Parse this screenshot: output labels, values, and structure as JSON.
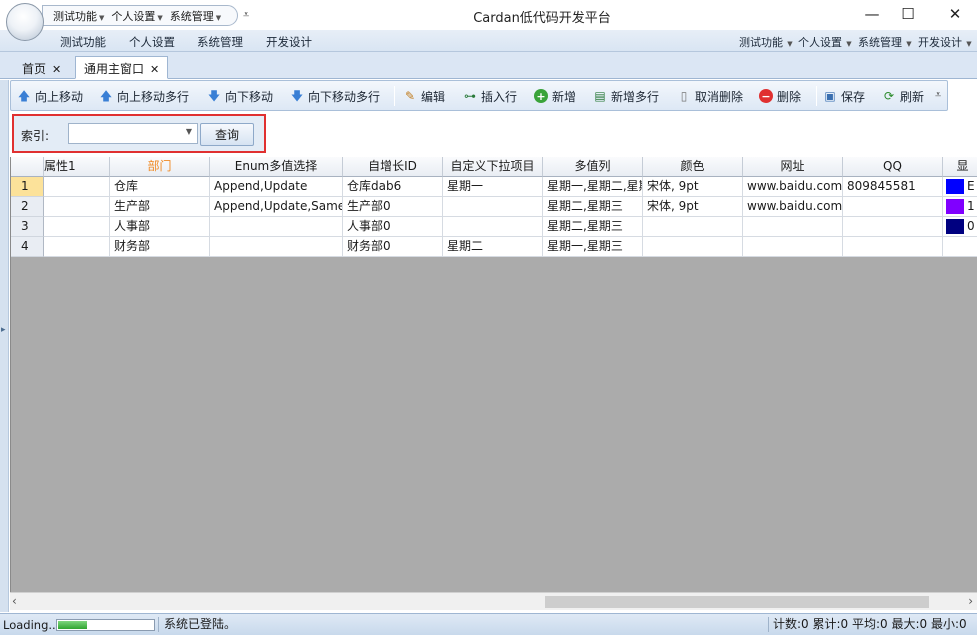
{
  "app": {
    "title": "Cardan低代码开发平台"
  },
  "quick_access": {
    "items": [
      "测试功能",
      "个人设置",
      "系统管理"
    ],
    "more": "⩡"
  },
  "ribbon": {
    "tabs": [
      "测试功能",
      "个人设置",
      "系统管理",
      "开发设计"
    ],
    "menus": [
      "测试功能",
      "个人设置",
      "系统管理",
      "开发设计"
    ]
  },
  "doc_tabs": [
    {
      "label": "首页",
      "close": "✕"
    },
    {
      "label": "通用主窗口",
      "close": "✕"
    }
  ],
  "toolbar": {
    "buttons": [
      {
        "icon": "arrow-up-icon",
        "label": "向上移动"
      },
      {
        "icon": "arrow-up-multi-icon",
        "label": "向上移动多行"
      },
      {
        "icon": "arrow-down-icon",
        "label": "向下移动"
      },
      {
        "icon": "arrow-down-multi-icon",
        "label": "向下移动多行"
      },
      {
        "icon": "edit-icon",
        "label": "编辑"
      },
      {
        "icon": "insert-row-icon",
        "label": "插入行"
      },
      {
        "icon": "add-icon",
        "label": "新增"
      },
      {
        "icon": "add-multi-icon",
        "label": "新增多行"
      },
      {
        "icon": "trash-icon",
        "label": "取消删除"
      },
      {
        "icon": "delete-icon",
        "label": "删除"
      },
      {
        "icon": "save-icon",
        "label": "保存"
      },
      {
        "icon": "refresh-icon",
        "label": "刷新"
      }
    ]
  },
  "query": {
    "label": "索引:",
    "value": "",
    "button": "查询"
  },
  "grid": {
    "columns": [
      "属性1",
      "部门",
      "Enum多值选择",
      "自增长ID",
      "自定义下拉项目",
      "多值列",
      "颜色",
      "网址",
      "QQ",
      "显"
    ],
    "selected_column": 1,
    "rows": [
      {
        "num": "1",
        "cells": [
          "",
          "仓库",
          "Append,Update",
          "仓库dab6",
          "星期一",
          "星期一,星期二,星期",
          "宋体, 9pt",
          "www.baidu.com",
          "809845581",
          "E"
        ],
        "color": "#0000ff"
      },
      {
        "num": "2",
        "cells": [
          "",
          "生产部",
          "Append,Update,Same",
          "生产部0",
          "",
          "星期二,星期三",
          "宋体, 9pt",
          "www.baidu.com",
          "",
          "1"
        ],
        "color": "#8000ff"
      },
      {
        "num": "3",
        "cells": [
          "",
          "人事部",
          "",
          "人事部0",
          "",
          "星期二,星期三",
          "",
          "",
          "",
          "0"
        ],
        "color": "#000080"
      },
      {
        "num": "4",
        "cells": [
          "",
          "财务部",
          "",
          "财务部0",
          "星期二",
          "星期一,星期三",
          "",
          "",
          "",
          ""
        ],
        "color": ""
      }
    ]
  },
  "status": {
    "loading": "Loading...",
    "progress": 0.3,
    "message": "系统已登陆。",
    "stats": "计数:0 累计:0 平均:0 最大:0 最小:0"
  }
}
